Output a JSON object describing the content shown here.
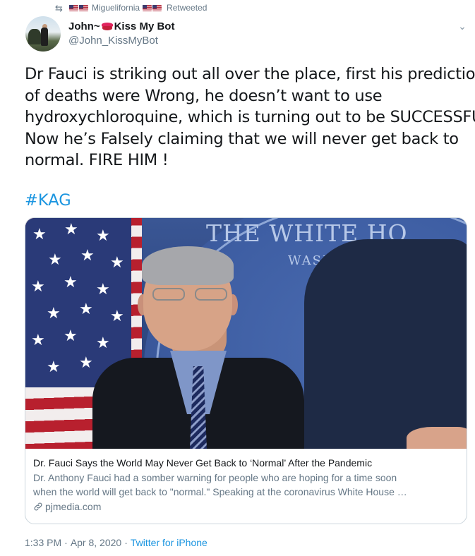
{
  "retweet": {
    "icon": "retweet-icon",
    "user": "Miguelifornia",
    "label": "Retweeted"
  },
  "author": {
    "name_prefix": "John~",
    "name_suffix": "Kiss My Bot",
    "handle": "@John_KissMyBot"
  },
  "tweet": {
    "lines": [
      "Dr Fauci is striking out all over the place, first his predictions",
      "of deaths were Wrong,  he doesn’t want to use",
      "hydroxychloroquine, which is turning out to be SUCCESSFUL.",
      "Now he’s Falsely claiming that we will never get back to",
      "normal. FIRE HIM !"
    ],
    "hashtag": "#KAG"
  },
  "card": {
    "image_text": {
      "heading": "THE WHITE HO",
      "subheading": "WASHIN"
    },
    "title": "Dr. Fauci Says the World May Never Get Back to ‘Normal’ After the Pandemic",
    "description_lines": [
      "Dr. Anthony Fauci had a somber warning for people who are hoping for a time soon",
      "when the world will get back to \"normal.\" Speaking at the coronavirus White House …"
    ],
    "domain": "pjmedia.com"
  },
  "meta": {
    "time": "1:33 PM",
    "separator": "·",
    "date": "Apr 8, 2020",
    "source": "Twitter for iPhone"
  },
  "colors": {
    "link": "#1b95e0",
    "secondary_text": "#657786",
    "primary_text": "#14171a",
    "card_border": "#ccd6dd"
  }
}
